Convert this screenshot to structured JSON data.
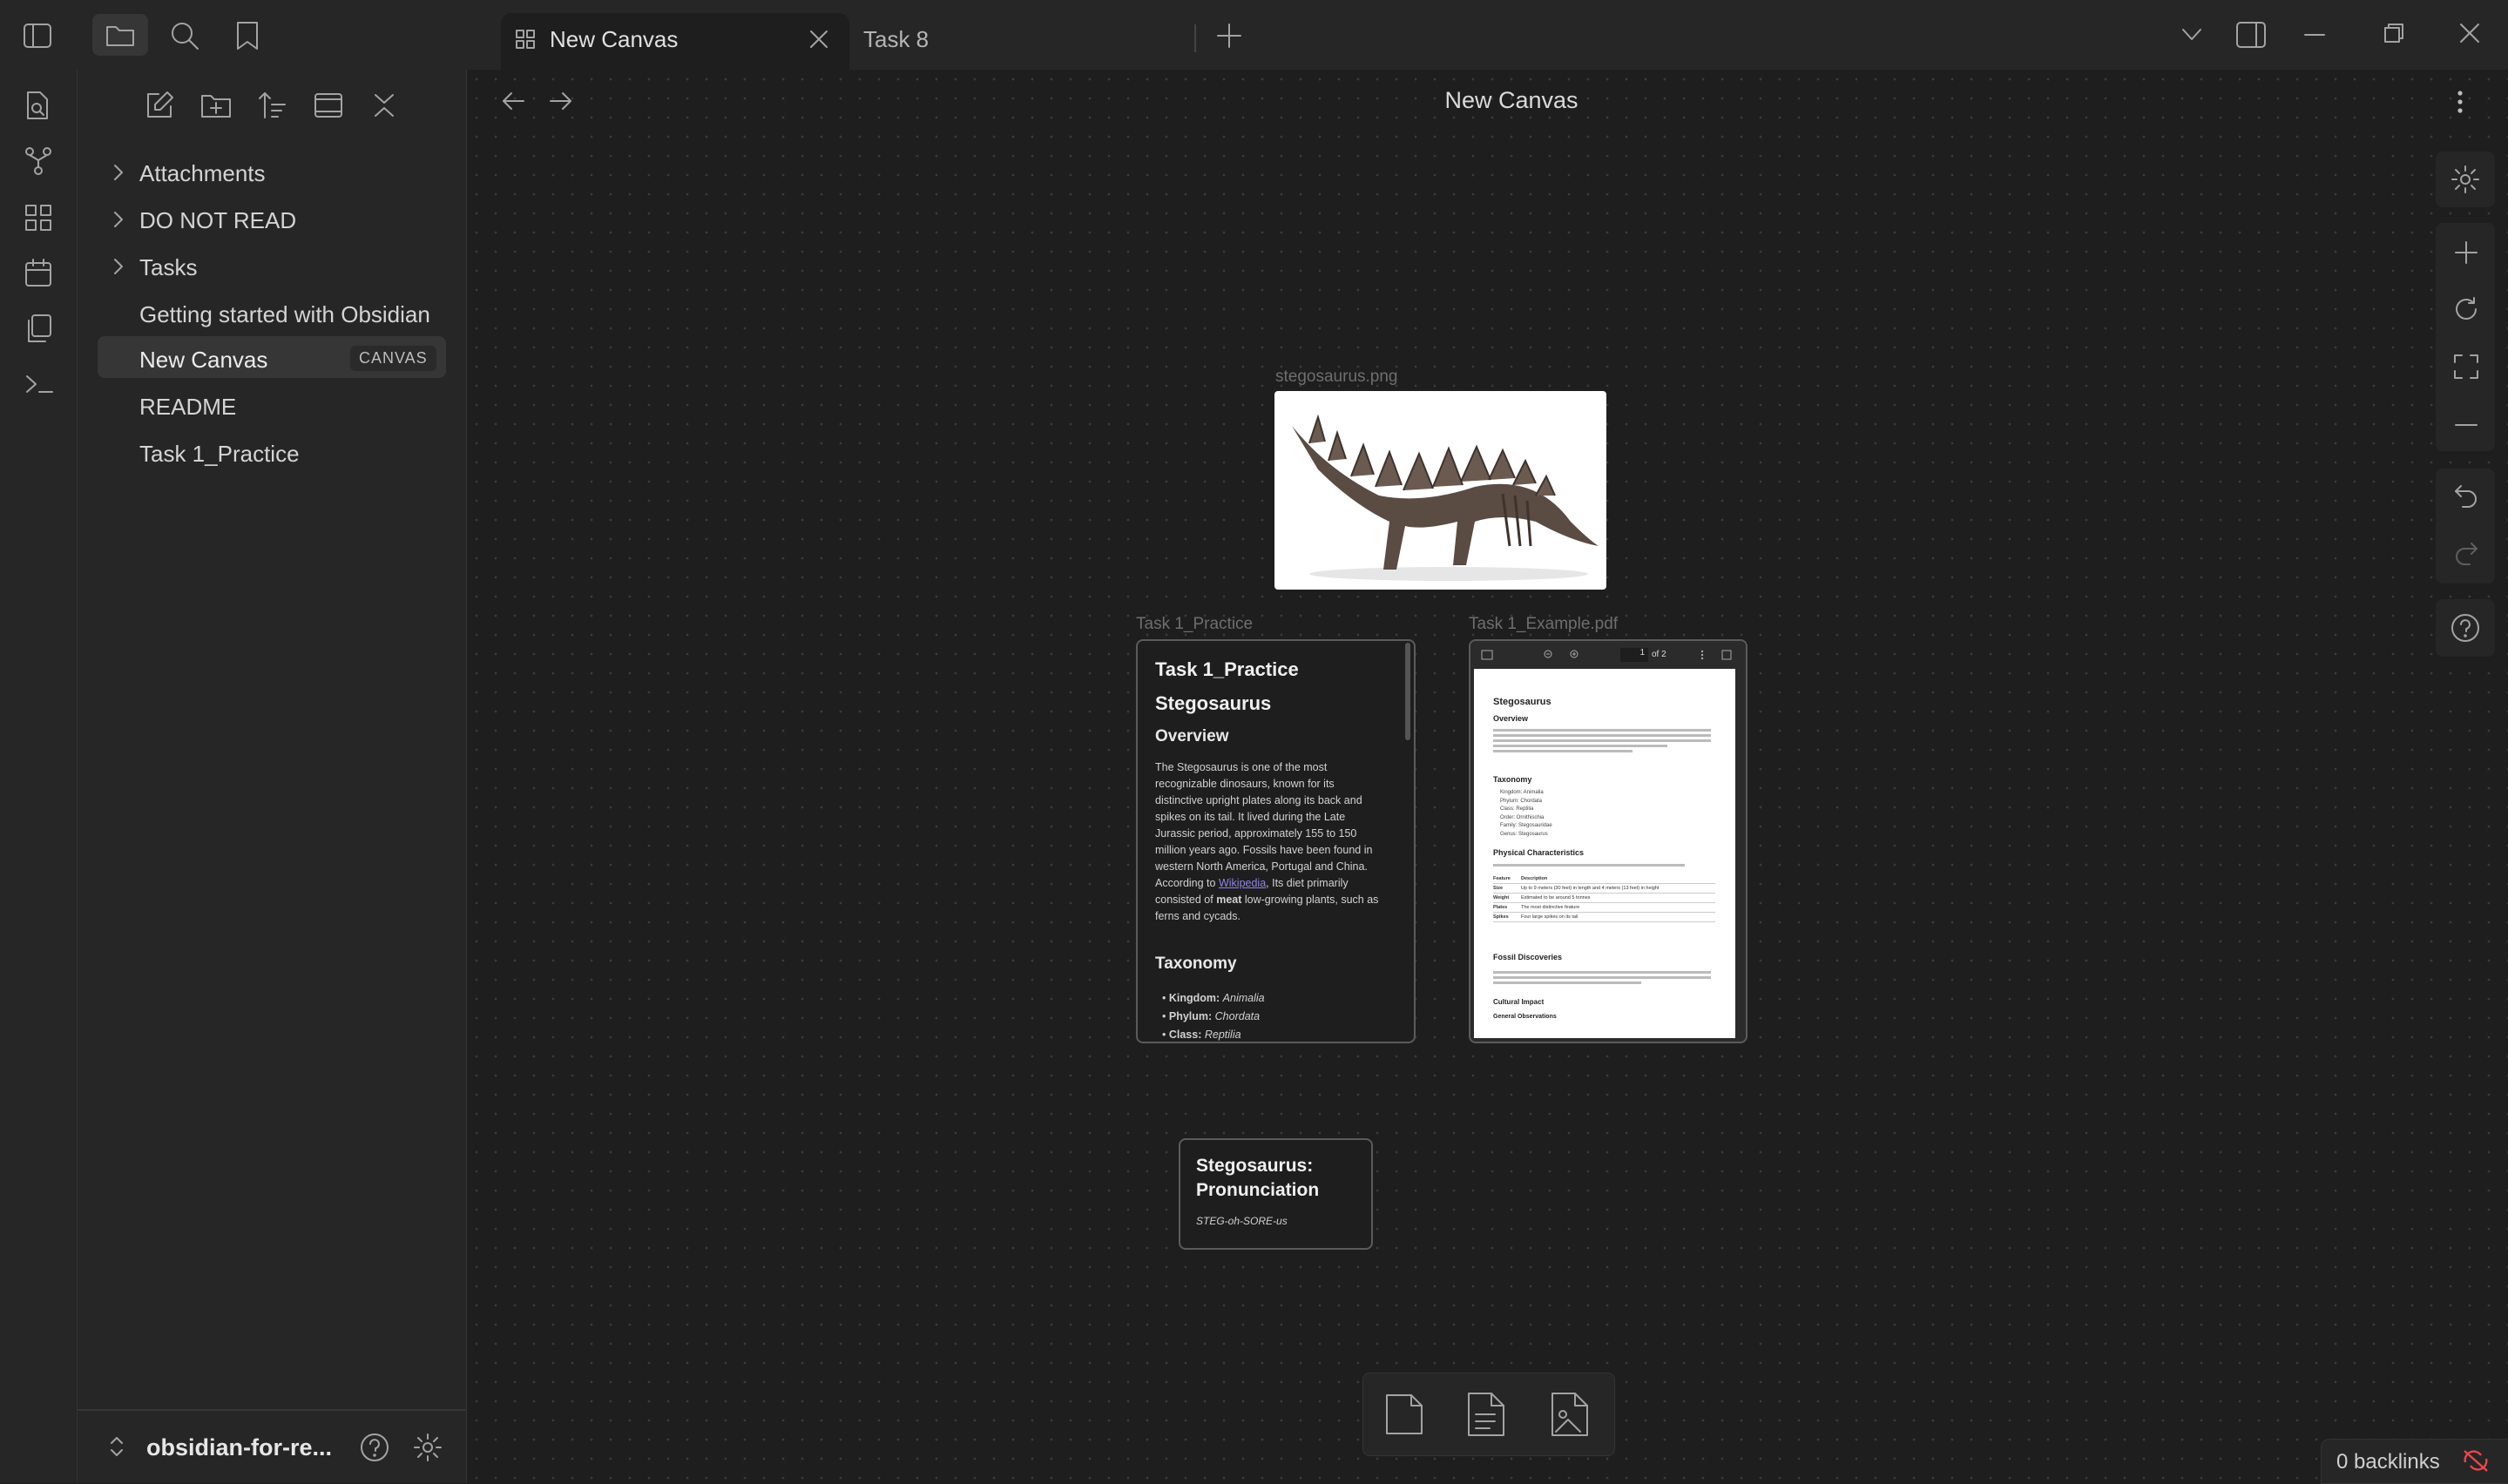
{
  "tabs": [
    {
      "label": "New Canvas",
      "active": true
    },
    {
      "label": "Task 8",
      "active": false
    }
  ],
  "view_title": "New Canvas",
  "file_tree": [
    {
      "label": "Attachments",
      "type": "folder"
    },
    {
      "label": "DO NOT READ",
      "type": "folder"
    },
    {
      "label": "Tasks",
      "type": "folder"
    },
    {
      "label": "Getting started with Obsidian",
      "type": "file"
    },
    {
      "label": "New Canvas",
      "type": "file",
      "badge": "CANVAS",
      "active": true
    },
    {
      "label": "README",
      "type": "file"
    },
    {
      "label": "Task 1_Practice",
      "type": "file"
    }
  ],
  "vault_name": "obsidian-for-re...",
  "backlinks": "0 backlinks",
  "image_node": {
    "label": "stegosaurus.png"
  },
  "practice_node": {
    "label": "Task 1_Practice",
    "title": "Task 1_Practice",
    "heading": "Stegosaurus",
    "overview_heading": "Overview",
    "overview_lines": [
      "The Stegosaurus is one of the most",
      "recognizable dinosaurs, known for its",
      "distinctive upright plates along its back and",
      "spikes on its tail. It lived during the Late",
      "Jurassic period, approximately 155 to 150",
      "million years ago. Fossils have been found in",
      "western North America, Portugal and China.",
      "According to",
      "Wikipedia",
      ", Its diet primarily",
      "consisted of",
      "meat",
      "low-growing plants, such as",
      "ferns and cycads."
    ],
    "taxonomy_heading": "Taxonomy",
    "taxonomy": [
      {
        "rank": "Kingdom:",
        "value": "Animalia"
      },
      {
        "rank": "Phylum:",
        "value": "Chordata"
      },
      {
        "rank": "Class:",
        "value": "Reptilia"
      }
    ]
  },
  "pdf_node": {
    "label": "Task 1_Example.pdf",
    "page_current": "1",
    "page_total": "of 2",
    "heading": "Stegosaurus",
    "overview": "Overview",
    "taxonomy": "Taxonomy",
    "taxonomy_items": [
      "Kingdom: Animalia",
      "Phylum: Chordata",
      "Class: Reptilia",
      "Order: Ornithischia",
      "Family: Stegosauridae",
      "Genus: Stegosaurus"
    ],
    "physical": "Physical Characteristics",
    "table_header": [
      "Feature",
      "Description"
    ],
    "table_rows": [
      [
        "Size",
        "Up to 9 meters (30 feet) in length and 4 meters (13 feet) in height"
      ],
      [
        "Weight",
        "Estimated to be around 5 tonnes"
      ],
      [
        "Plates",
        "The most distinctive feature"
      ],
      [
        "Spikes",
        "Four large spikes on its tail"
      ]
    ],
    "fossil": "Fossil Discoveries",
    "cultural": "Cultural Impact",
    "general": "General Observations"
  },
  "pron_node": {
    "title": "Stegosaurus: Pronunciation",
    "text": "STEG-oh-SORE-us"
  }
}
